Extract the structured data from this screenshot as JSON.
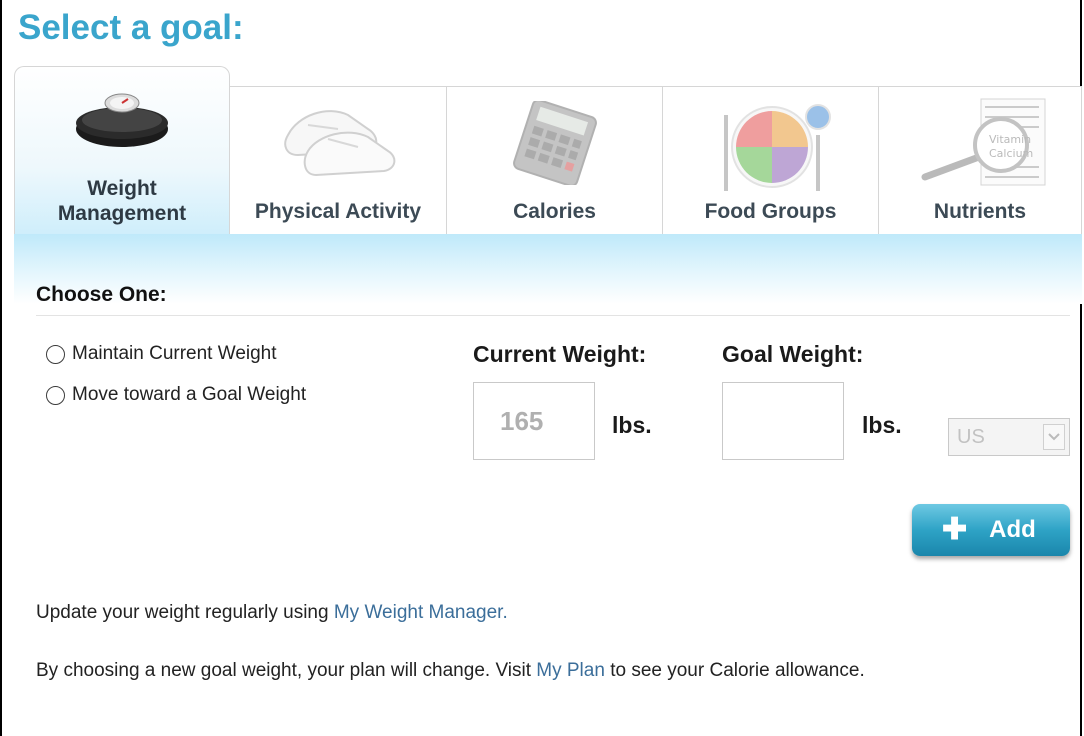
{
  "title": "Select a goal:",
  "tabs": [
    {
      "label_1": "Weight",
      "label_2": "Management",
      "icon": "scale-icon",
      "active": true
    },
    {
      "label": "Physical Activity",
      "icon": "sneakers-icon"
    },
    {
      "label": "Calories",
      "icon": "calculator-icon"
    },
    {
      "label": "Food Groups",
      "icon": "plate-icon"
    },
    {
      "label": "Nutrients",
      "icon": "magnifier-icon"
    }
  ],
  "choose_one": "Choose One:",
  "options": [
    {
      "label": "Maintain Current Weight",
      "selected": false
    },
    {
      "label": "Move toward a Goal Weight",
      "selected": false
    }
  ],
  "current_weight": {
    "label": "Current Weight:",
    "value": "165",
    "unit": "lbs."
  },
  "goal_weight": {
    "label": "Goal Weight:",
    "value": "",
    "unit": "lbs."
  },
  "unit_select": {
    "value": "US"
  },
  "add_button": {
    "label": "Add"
  },
  "note1": {
    "pre": "Update your weight regularly using ",
    "link": "My Weight Manager."
  },
  "note2": {
    "pre": "By choosing a new goal weight, your plan will change. Visit ",
    "link": "My Plan",
    "post": " to see your Calorie allowance."
  },
  "colors": {
    "title": "#3aa5cc",
    "link": "#3b6e9a",
    "button": "#2ea3c6"
  }
}
